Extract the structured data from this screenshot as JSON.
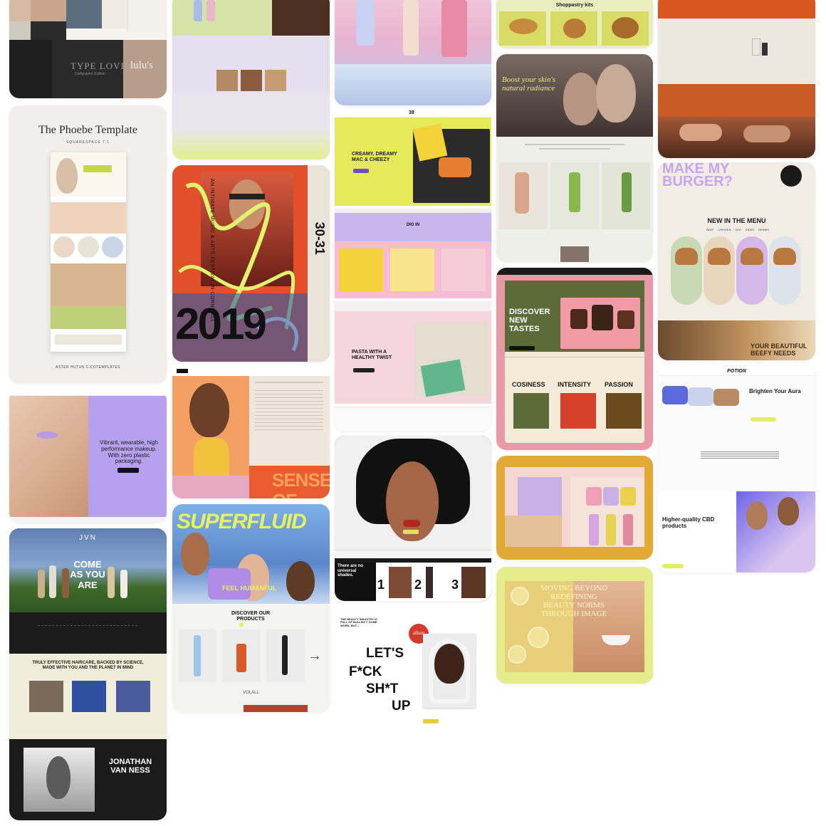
{
  "cards": {
    "type_love": {
      "logo_text": "TYPE LOVE",
      "logo_sub": "Calligraphic Edition",
      "word": "lulu's"
    },
    "phoebe": {
      "title": "The Phoebe Template",
      "subtitle": "SQUARESPACE 7.1",
      "footer": "ASTER HUTUS C.COTEMPLATES"
    },
    "swatches": {},
    "festival": {
      "date": "AUGUST 30-31",
      "side": "AN INTIMATE MUSIC & ARTS FESTIVAL IN CORNWALL",
      "big": "2019"
    },
    "pasta": {
      "logo": "38",
      "hero_title": "CREAMY, DREAMY MAC & CHEEZY",
      "band_title": "DIG IN",
      "pasta_title": "PASTA WITH A HEALTHY TWIST"
    },
    "shop_pastry": {
      "title": "Shoppastry kits"
    },
    "skin": {
      "headline": "Boost your skin's natural radiance"
    },
    "terracotta": {},
    "burger": {
      "headline": "MAKE MY BURGER?",
      "badge": "MAKE MY BURGER?",
      "menu_title": "NEW IN THE MENU",
      "tabs": [
        "BEEF",
        "CHICKEN",
        "VEG",
        "SIDES",
        "DRINKS"
      ],
      "footer": "YOUR BEAUTIFUL BEEFY NEEDS"
    },
    "discover": {
      "title": "DISCOVER NEW TASTES",
      "products": [
        "COSINESS",
        "INTENSITY",
        "PASSION"
      ]
    },
    "sense": {
      "text": "SENSE OF"
    },
    "makeup": {
      "headline": "Vibrant, wearable, high performance makeup. With zero plastic packaging."
    },
    "potion": {
      "logo": "POTION",
      "hero_title": "Brighten Your Aura",
      "cbd": "Higher-quality CBD products"
    },
    "superfluid": {
      "title": "SUPERFLUID",
      "tagline": "FEEL HUMANFUL",
      "products_title": "DISCOVER OUR PRODUCTS",
      "footer": "VOLALL"
    },
    "portrait": {
      "row_numbers": [
        "1",
        "2",
        "3"
      ],
      "shades": "There are no universal shades."
    },
    "jvn": {
      "logo": "JVN",
      "hero": "COME AS YOU ARE",
      "mid_title": "TRULY EFFECTIVE HAIRCARE, BACKED BY SCIENCE, MADE WITH YOU AND THE PLANET IN MIND",
      "name": "JONATHAN VAN NESS"
    },
    "allure": {
      "intro": "THE BEAUTY INDUSTRY IS FULL OF BULLSH*T. SOME WORK, BUT...",
      "headline": [
        "LET'S",
        "F*CK",
        "SH*T",
        "UP"
      ],
      "badge": "allure"
    },
    "palette": {},
    "lemon": {
      "headline": "MOVING BEYOND REDEFINING BEAUTY NORMS THROUGH IMAGE"
    }
  },
  "colors": {
    "lime": "#dfe96a",
    "lavender": "#c9b4f0",
    "orange": "#e85a2c",
    "terracotta": "#c85a26",
    "pink": "#f4d4e0",
    "mustard": "#e3a935",
    "olive": "#5c6b3a",
    "yellow_lemon": "#e6ec8c"
  }
}
